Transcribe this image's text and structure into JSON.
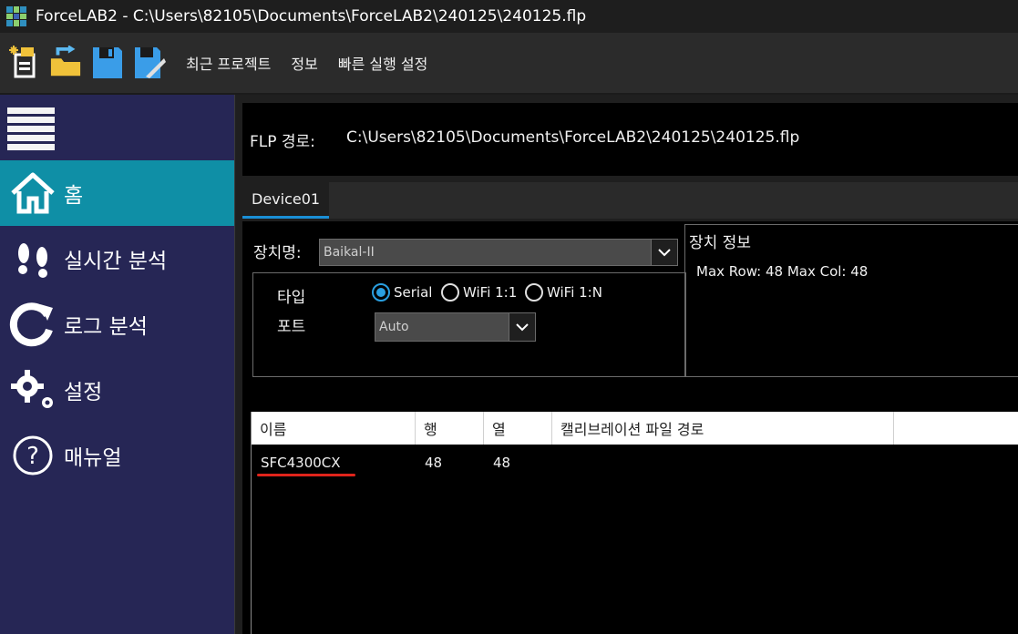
{
  "window": {
    "title": "ForceLAB2 - C:\\Users\\82105\\Documents\\ForceLAB2\\240125\\240125.flp"
  },
  "toolbar": {
    "icons": [
      "new-project-icon",
      "open-folder-icon",
      "save-icon",
      "save-as-icon"
    ],
    "menu": [
      "최근 프로젝트",
      "정보",
      "빠른 실행 설정"
    ]
  },
  "sidebar": {
    "items": [
      {
        "label": "홈",
        "icon": "home-icon",
        "active": true
      },
      {
        "label": "실시간 분석",
        "icon": "footprints-icon",
        "active": false
      },
      {
        "label": "로그 분석",
        "icon": "refresh-icon",
        "active": false
      },
      {
        "label": "설정",
        "icon": "gears-icon",
        "active": false
      },
      {
        "label": "매뉴얼",
        "icon": "help-icon",
        "active": false
      }
    ]
  },
  "main": {
    "path_label": "FLP 경로:",
    "path_value": "C:\\Users\\82105\\Documents\\ForceLAB2\\240125\\240125.flp",
    "tab": "Device01",
    "device_name_label": "장치명:",
    "device_name_value": "Baikal-II",
    "type_label": "타입",
    "port_label": "포트",
    "radio_options": [
      "Serial",
      "WiFi 1:1",
      "WiFi 1:N"
    ],
    "selected_radio": "Serial",
    "port_value": "Auto",
    "info_title": "장치 정보",
    "info_text": "Max Row: 48  Max Col: 48",
    "table": {
      "headers": [
        "이름",
        "행",
        "열",
        "캘리브레이션 파일 경로"
      ],
      "rows": [
        {
          "name": "SFC4300CX",
          "rows": "48",
          "cols": "48",
          "path": ""
        }
      ]
    }
  },
  "colors": {
    "sidebar_bg": "#262655",
    "active_item": "#0f8fa6",
    "accent": "#2a9fe0",
    "underline": "#e0241b"
  }
}
